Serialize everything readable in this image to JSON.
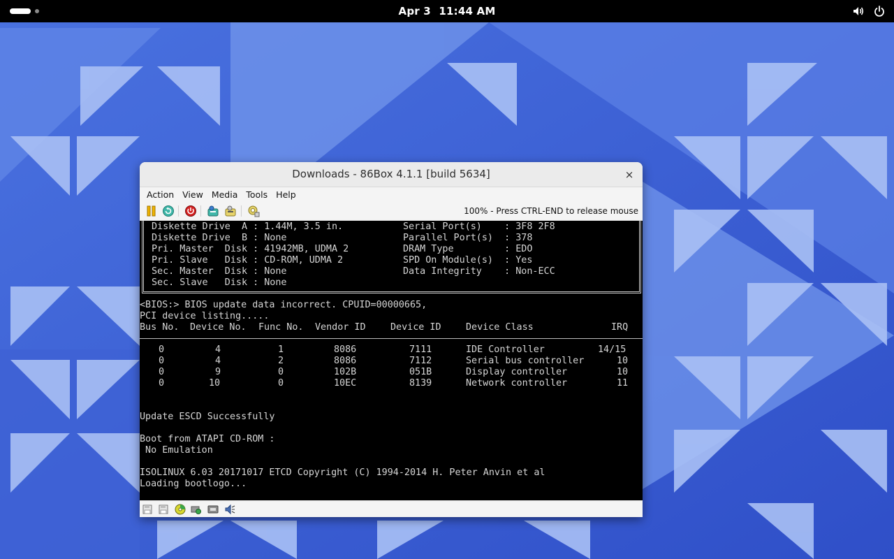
{
  "topbar": {
    "date": "Apr 3",
    "time": "11:44 AM",
    "icons": [
      "activities-indicator",
      "volume-icon",
      "power-icon"
    ]
  },
  "window": {
    "title": "Downloads - 86Box 4.1.1 [build 5634]",
    "close_label": "×",
    "menu": [
      "Action",
      "View",
      "Media",
      "Tools",
      "Help"
    ],
    "toolbar_icons": [
      "pause-icon",
      "hard-reset-icon",
      "ctrl-alt-del-icon",
      "ctrl-alt-esc-icon",
      "settings-icon",
      "screenshot-icon"
    ],
    "mouse_status": "100% - Press CTRL-END to release mouse",
    "statusbar_icons": [
      "floppy-a-icon",
      "floppy-b-icon",
      "cdrom-icon",
      "hard-disk-icon",
      "network-icon",
      "sound-icon"
    ]
  },
  "screen": {
    "config_rows": [
      {
        "left": "Diskette Drive  A : 1.44M, 3.5 in.",
        "right": "Serial Port(s)    : 3F8 2F8"
      },
      {
        "left": "Diskette Drive  B : None",
        "right": "Parallel Port(s)  : 378"
      },
      {
        "left": "Pri. Master  Disk : 41942MB, UDMA 2",
        "right": "DRAM Type         : EDO"
      },
      {
        "left": "Pri. Slave   Disk : CD-ROM, UDMA 2",
        "right": "SPD On Module(s)  : Yes"
      },
      {
        "left": "Sec. Master  Disk : None",
        "right": "Data Integrity    : Non-ECC"
      },
      {
        "left": "Sec. Slave   Disk : None",
        "right": ""
      }
    ],
    "bios_line": "<BIOS:> BIOS update data incorrect. CPUID=00000665,",
    "pci_title": "PCI device listing.....",
    "pci_headers": [
      "Bus No.",
      "Device No.",
      "Func No.",
      "Vendor ID",
      "Device ID",
      "Device Class",
      "IRQ"
    ],
    "pci_rows": [
      [
        "0",
        "4",
        "1",
        "8086",
        "7111",
        "IDE Controller",
        "14/15"
      ],
      [
        "0",
        "4",
        "2",
        "8086",
        "7112",
        "Serial bus controller",
        "10"
      ],
      [
        "0",
        "9",
        "0",
        "102B",
        "051B",
        "Display controller",
        "10"
      ],
      [
        "0",
        "10",
        "0",
        "10EC",
        "8139",
        "Network controller",
        "11"
      ]
    ],
    "escd_line": "Update ESCD Successfully",
    "boot_line1": "Boot from ATAPI CD-ROM :",
    "boot_line2": " No Emulation",
    "isolinux_line": "ISOLINUX 6.03 20171017 ETCD Copyright (C) 1994-2014 H. Peter Anvin et al",
    "loading_line": "Loading bootlogo..."
  }
}
